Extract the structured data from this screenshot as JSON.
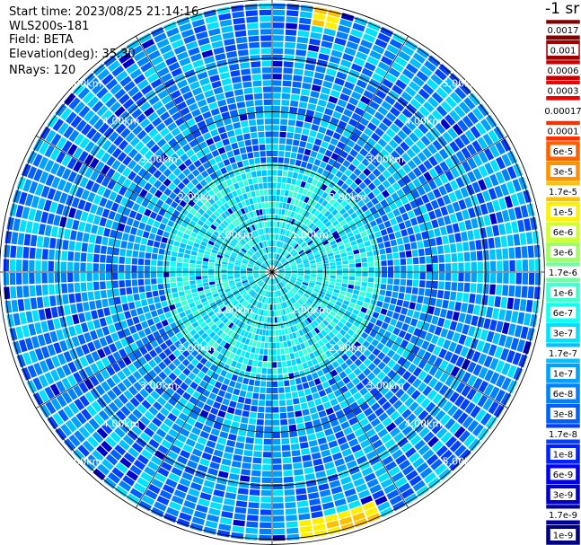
{
  "header": {
    "start_time": "Start time: 2023/08/25 21:14:16",
    "instrument": "WLS200s-181",
    "field": "Field: BETA",
    "elevation": "Elevation(deg): 35.30",
    "nrays": "NRays: 120"
  },
  "colorbar": {
    "unit_label": "-1 sr",
    "labels": [
      "0.0017",
      "0.001",
      "0.0006",
      "0.0003",
      "0.00017",
      "0.0001",
      "6e-5",
      "3e-5",
      "1.7e-5",
      "1e-5",
      "6e-6",
      "3e-6",
      "1.7e-6",
      "1e-6",
      "6e-7",
      "3e-7",
      "1.7e-7",
      "1e-7",
      "6e-8",
      "3e-8",
      "1.7e-8",
      "1e-8",
      "6e-9",
      "3e-9",
      "1.7e-9",
      "1e-9"
    ],
    "colors": [
      "#800000",
      "#a00000",
      "#c80000",
      "#f00000",
      "#ffffff",
      "#ff3000",
      "#ff6000",
      "#ff9000",
      "#ffc000",
      "#fff000",
      "#d0ff30",
      "#a0ff60",
      "#70ffa0",
      "#40ffd0",
      "#10fff0",
      "#00e0ff",
      "#00c0ff",
      "#00a0ff",
      "#0080ff",
      "#0060ff",
      "#0040ff",
      "#0020ff",
      "#0000f0",
      "#0000c8",
      "#0000a0",
      "#000080"
    ]
  },
  "chart_data": {
    "type": "heatmap",
    "projection": "polar (PPI scan)",
    "field": "BETA",
    "elevation_deg": 35.3,
    "n_rays": 120,
    "range_rings_km": [
      1.0,
      2.0,
      3.0,
      4.0,
      5.0
    ],
    "ring_labels": [
      "1.00km",
      "2.00km",
      "3.00km",
      "4.00km",
      "5.00km"
    ],
    "max_range_km": 5.1,
    "radials_deg": [
      0,
      30,
      60,
      90,
      120,
      150,
      180,
      210,
      240,
      270,
      300,
      330
    ],
    "color_scale": "log",
    "value_range": [
      1e-09,
      0.0017
    ],
    "typical_values": {
      "inner_0_to_2km": "3e-7 to 1e-6",
      "outer_2_to_5km": "1e-8 to 1e-7",
      "hotspots": "up to ~1.7e-5 near the edge (north and south-southeast)"
    }
  }
}
